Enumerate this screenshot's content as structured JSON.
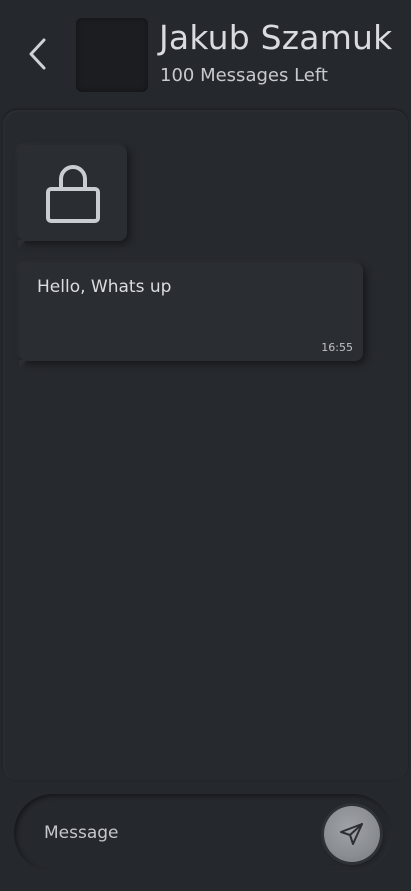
{
  "header": {
    "contact_name": "Jakub Szamuk",
    "subtitle": "100 Messages Left",
    "back_icon": "chevron-left-icon",
    "avatar_color": "#1b1d20"
  },
  "messages": [
    {
      "type": "locked",
      "icon": "lock-icon"
    },
    {
      "type": "text",
      "text": "Hello, Whats up",
      "time": "16:55"
    }
  ],
  "composer": {
    "placeholder": "Message",
    "send_icon": "send-icon"
  },
  "colors": {
    "background": "#25282d",
    "bubble": "#2a2d32",
    "send_button": "#8a8d91"
  }
}
